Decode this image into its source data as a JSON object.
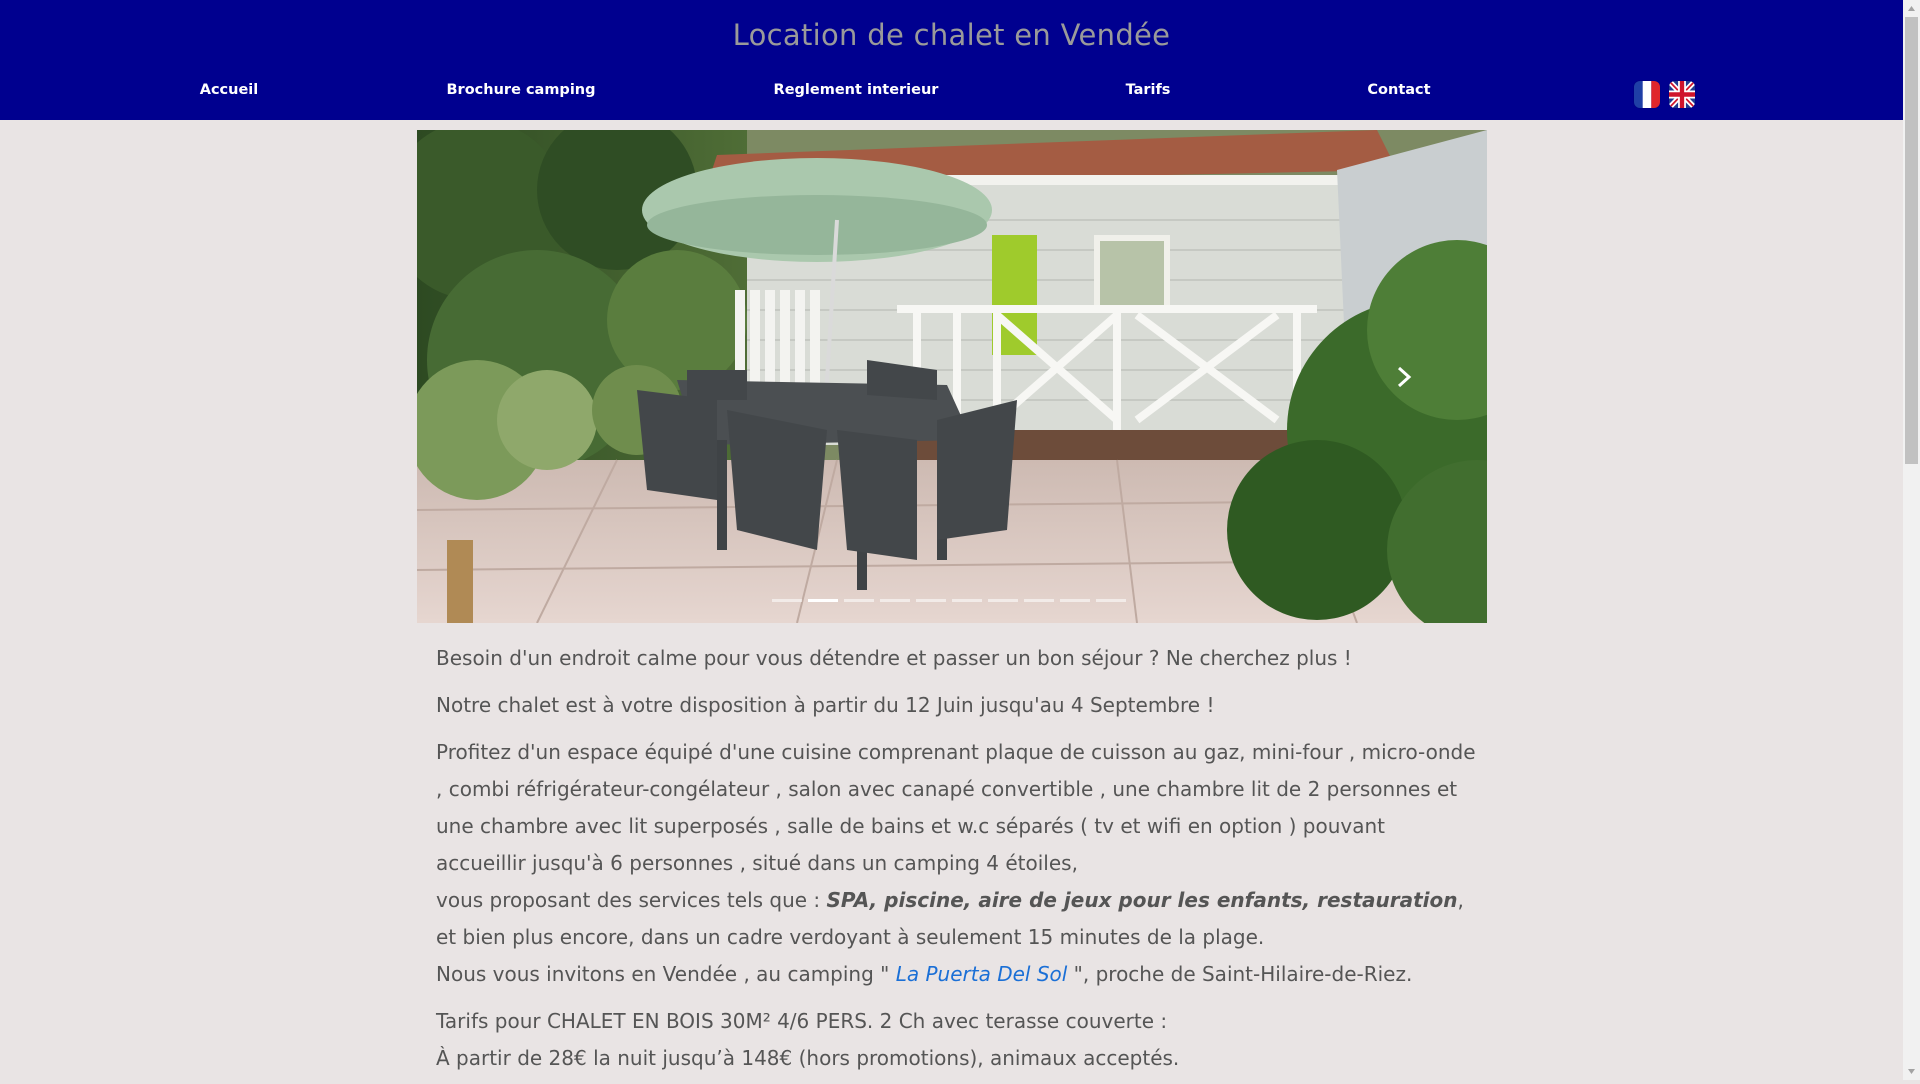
{
  "header": {
    "title": "Location de chalet en Vendée",
    "nav": [
      {
        "label": "Accueil"
      },
      {
        "label": "Brochure camping"
      },
      {
        "label": "Reglement interieur"
      },
      {
        "label": "Tarifs"
      },
      {
        "label": "Contact"
      }
    ],
    "languages": [
      "fr-flag-icon",
      "uk-flag-icon"
    ],
    "colors": {
      "background": "#00008f",
      "title": "#9a9a9a",
      "nav_text": "#ffffff"
    }
  },
  "slider": {
    "indicator_count": 10,
    "active_index": 1,
    "next_icon": "chevron-right-icon"
  },
  "content": {
    "p1": "Besoin d'un endroit calme pour vous détendre et passer un bon séjour ? Ne cherchez plus !",
    "p2": "Notre chalet est à votre disposition à partir du 12 Juin jusqu'au 4 Septembre !",
    "p3": "Profitez d'un espace équipé d'une cuisine comprenant plaque de cuisson au gaz, mini-four , micro-onde , combi réfrigérateur-congélateur , salon avec canapé convertible , une chambre lit de 2 personnes et une chambre avec lit superposés , salle de bains et w.c séparés ( tv et wifi en option ) pouvant accueillir jusqu'à 6 personnes , situé dans un camping 4 étoiles,",
    "p4_prefix": "vous proposant des services tels que : ",
    "services": [
      "SPA",
      "piscine",
      "aire de jeux pour les enfants",
      "restauration"
    ],
    "sep": ", ",
    "p4_suffix": ", et bien plus encore, dans un cadre verdoyant à seulement 15 minutes de la plage.",
    "p5_prefix": "Nous vous invitons en Vendée , au camping \" ",
    "camping_name": "La Puerta Del Sol",
    "p5_suffix": " \", proche de Saint-Hilaire-de-Riez.",
    "tarif_line1": "Tarifs pour CHALET EN BOIS 30M² 4/6 PERS. 2 Ch avec terasse couverte :",
    "tarif_line2": "À partir de 28€ la nuit jusqu’à 148€ (hors promotions), animaux acceptés."
  },
  "colors": {
    "page_background": "#e9e4e4",
    "text": "#555555",
    "link": "#1a6fd6"
  }
}
